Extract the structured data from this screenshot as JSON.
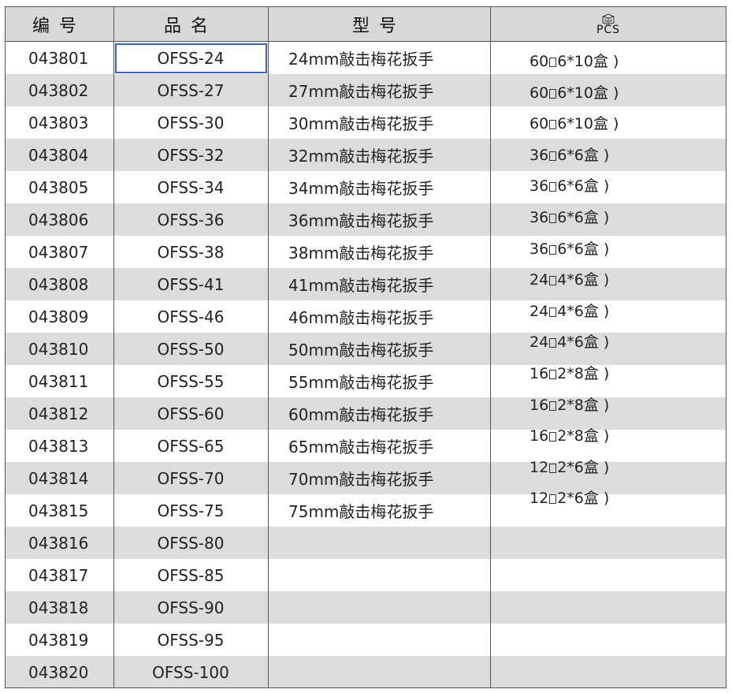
{
  "header": {
    "col1": "编号",
    "col2": "品名",
    "col3": "型号",
    "col4_unit": "PCS",
    "col4_icon": "box-icon"
  },
  "rows": [
    {
      "code": "043801",
      "name": "OFSS-24",
      "spec": "24mm敲击梅花扳手"
    },
    {
      "code": "043802",
      "name": "OFSS-27",
      "spec": "27mm敲击梅花扳手"
    },
    {
      "code": "043803",
      "name": "OFSS-30",
      "spec": "30mm敲击梅花扳手"
    },
    {
      "code": "043804",
      "name": "OFSS-32",
      "spec": "32mm敲击梅花扳手"
    },
    {
      "code": "043805",
      "name": "OFSS-34",
      "spec": "34mm敲击梅花扳手"
    },
    {
      "code": "043806",
      "name": "OFSS-36",
      "spec": "36mm敲击梅花扳手"
    },
    {
      "code": "043807",
      "name": "OFSS-38",
      "spec": "38mm敲击梅花扳手"
    },
    {
      "code": "043808",
      "name": "OFSS-41",
      "spec": "41mm敲击梅花扳手"
    },
    {
      "code": "043809",
      "name": "OFSS-46",
      "spec": "46mm敲击梅花扳手"
    },
    {
      "code": "043810",
      "name": "OFSS-50",
      "spec": "50mm敲击梅花扳手"
    },
    {
      "code": "043811",
      "name": "OFSS-55",
      "spec": "55mm敲击梅花扳手"
    },
    {
      "code": "043812",
      "name": "OFSS-60",
      "spec": "60mm敲击梅花扳手"
    },
    {
      "code": "043813",
      "name": "OFSS-65",
      "spec": "65mm敲击梅花扳手"
    },
    {
      "code": "043814",
      "name": "OFSS-70",
      "spec": "70mm敲击梅花扳手"
    },
    {
      "code": "043815",
      "name": "OFSS-75",
      "spec": "75mm敲击梅花扳手"
    },
    {
      "code": "043816",
      "name": "OFSS-80",
      "spec": ""
    },
    {
      "code": "043817",
      "name": "OFSS-85",
      "spec": ""
    },
    {
      "code": "043818",
      "name": "OFSS-90",
      "spec": ""
    },
    {
      "code": "043819",
      "name": "OFSS-95",
      "spec": ""
    },
    {
      "code": "043820",
      "name": "OFSS-100",
      "spec": ""
    }
  ],
  "pcs": [
    {
      "a": "60",
      "b": "6*10盒 )"
    },
    {
      "a": "60",
      "b": "6*10盒 )"
    },
    {
      "a": "60",
      "b": "6*10盒 )"
    },
    {
      "a": "36",
      "b": "6*6盒 )"
    },
    {
      "a": "36",
      "b": "6*6盒 )"
    },
    {
      "a": "36",
      "b": "6*6盒 )"
    },
    {
      "a": "36",
      "b": "6*6盒 )"
    },
    {
      "a": "24",
      "b": "4*6盒 )"
    },
    {
      "a": "24",
      "b": "4*6盒 )"
    },
    {
      "a": "24",
      "b": "4*6盒 )"
    },
    {
      "a": "16",
      "b": "2*8盒 )"
    },
    {
      "a": "16",
      "b": "2*8盒 )"
    },
    {
      "a": "16",
      "b": "2*8盒 )"
    },
    {
      "a": "12",
      "b": "2*6盒 )"
    },
    {
      "a": "12",
      "b": "2*6盒 )"
    }
  ]
}
